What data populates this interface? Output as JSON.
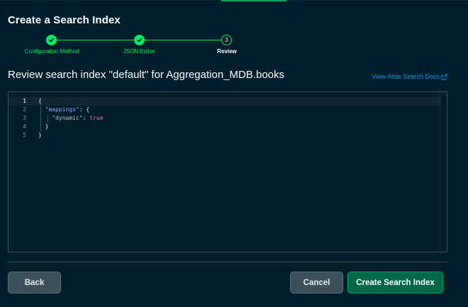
{
  "title": "Create a Search Index",
  "stepper": {
    "steps": [
      {
        "label": "Configuration Method",
        "state": "done"
      },
      {
        "label": "JSON Editor",
        "state": "done"
      },
      {
        "label": "Review",
        "state": "current",
        "number": "3"
      }
    ]
  },
  "subtitle": "Review search index \"default\" for Aggregation_MDB.books",
  "docs_link": "View Atlas Search Docs",
  "editor": {
    "line_numbers": [
      "1",
      "2",
      "3",
      "4",
      "5"
    ],
    "lines": {
      "l1": "{",
      "l2_key": "\"mappings\"",
      "l2_rest": ": {",
      "l3_key": "\"dynamic\"",
      "l3_colon": ": ",
      "l3_value": "true",
      "l4": "}",
      "l5": "}"
    }
  },
  "buttons": {
    "back": "Back",
    "cancel": "Cancel",
    "create": "Create Search Index"
  },
  "colors": {
    "background": "#001e2b",
    "accent_green": "#00ed64",
    "link_blue": "#0498ec",
    "primary_button": "#00684a"
  }
}
